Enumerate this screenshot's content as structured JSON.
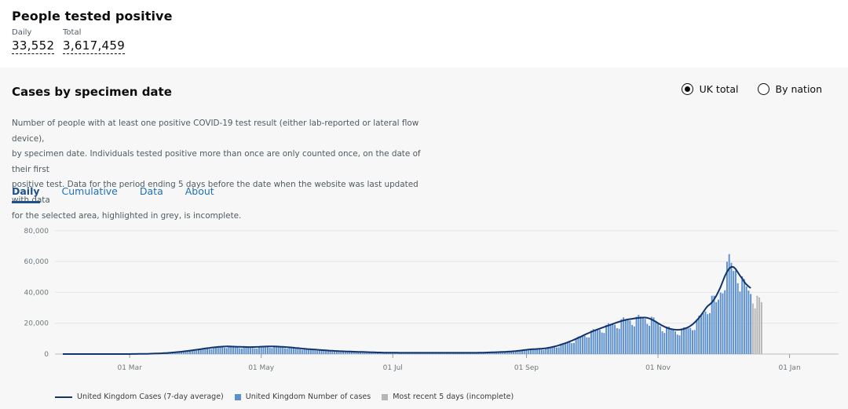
{
  "headline": {
    "title": "People tested positive",
    "daily_label": "Daily",
    "daily_value": "33,552",
    "total_label": "Total",
    "total_value": "3,617,459"
  },
  "card": {
    "title": "Cases by specimen date",
    "radio_options": [
      {
        "label": "UK total",
        "selected": true
      },
      {
        "label": "By nation",
        "selected": false
      }
    ],
    "description_lines": [
      "Number of people with at least one positive COVID-19 test result (either lab-reported or lateral flow device),",
      "by specimen date. Individuals tested positive more than once are only counted once, on the date of their first",
      "positive test. Data for the period ending 5 days before the date when the website was last updated with data",
      "for the selected area, highlighted in grey, is incomplete."
    ],
    "tabs": [
      {
        "label": "Daily",
        "active": true
      },
      {
        "label": "Cumulative",
        "active": false
      },
      {
        "label": "Data",
        "active": false
      },
      {
        "label": "About",
        "active": false
      }
    ]
  },
  "colors": {
    "bar": "#5b8fcd",
    "line": "#12336b",
    "incomplete": "#b5b5b5",
    "accent": "#1d70b8"
  },
  "chart_data": {
    "type": "bar",
    "y_ticks": [
      "80,000",
      "60,000",
      "40,000",
      "20,000",
      "0"
    ],
    "ylim": [
      0,
      85000
    ],
    "x_ticks": [
      "01 Mar",
      "01 May",
      "01 Jul",
      "01 Sep",
      "01 Nov",
      "01 Jan"
    ],
    "start_date": "2020-01-30",
    "end_date": "2021-01-23",
    "grid": true,
    "series": [
      {
        "name": "United Kingdom Cases (7-day average)",
        "kind": "line"
      },
      {
        "name": "United Kingdom Number of cases",
        "kind": "bar"
      },
      {
        "name": "Most recent 5 days (incomplete)",
        "kind": "bar"
      }
    ],
    "daily_values": [
      0,
      0,
      0,
      0,
      0,
      0,
      0,
      0,
      0,
      0,
      0,
      0,
      0,
      0,
      0,
      0,
      0,
      0,
      0,
      0,
      0,
      0,
      0,
      0,
      0,
      0,
      0,
      0,
      0,
      10,
      15,
      20,
      30,
      40,
      55,
      70,
      90,
      110,
      140,
      170,
      200,
      240,
      280,
      320,
      370,
      430,
      500,
      580,
      660,
      750,
      850,
      950,
      1100,
      1250,
      1400,
      1550,
      1700,
      1850,
      2000,
      2200,
      2400,
      2600,
      2800,
      3000,
      3200,
      3400,
      3600,
      3800,
      4000,
      4200,
      4400,
      4500,
      4700,
      4800,
      4900,
      5000,
      5000,
      4950,
      4900,
      4850,
      4800,
      4750,
      4700,
      4650,
      4600,
      4550,
      4500,
      4500,
      4500,
      4550,
      4600,
      4700,
      4800,
      4850,
      4900,
      4950,
      5000,
      5000,
      4950,
      4900,
      4850,
      4800,
      4700,
      4600,
      4500,
      4400,
      4300,
      4150,
      4000,
      3850,
      3700,
      3550,
      3400,
      3300,
      3200,
      3100,
      3000,
      2900,
      2800,
      2700,
      2600,
      2500,
      2400,
      2300,
      2200,
      2100,
      2000,
      1950,
      1900,
      1850,
      1800,
      1750,
      1700,
      1650,
      1600,
      1550,
      1500,
      1450,
      1400,
      1350,
      1300,
      1250,
      1200,
      1150,
      1100,
      1050,
      1000,
      980,
      960,
      940,
      920,
      900,
      880,
      860,
      850,
      840,
      830,
      820,
      810,
      800,
      800,
      800,
      800,
      800,
      800,
      800,
      800,
      800,
      800,
      800,
      800,
      800,
      800,
      800,
      800,
      800,
      800,
      800,
      800,
      800,
      800,
      800,
      800,
      800,
      800,
      800,
      800,
      800,
      800,
      800,
      800,
      800,
      800,
      800,
      850,
      900,
      950,
      1000,
      1050,
      1100,
      1150,
      1200,
      1250,
      1300,
      1350,
      1400,
      1500,
      1600,
      1700,
      1800,
      1900,
      2000,
      2200,
      2400,
      2600,
      2800,
      3000,
      3100,
      3200,
      3300,
      3300,
      3300,
      3400,
      3500,
      3700,
      3900,
      4200,
      4500,
      4800,
      5200,
      5600,
      6000,
      6500,
      7000,
      7500,
      8000,
      8600,
      9200,
      9800,
      10500,
      11200,
      11800,
      12500,
      13200,
      13800,
      14500,
      15000,
      15500,
      16000,
      16500,
      17000,
      17500,
      18000,
      18500,
      19000,
      19500,
      20000,
      20500,
      21000,
      21500,
      22000,
      22200,
      22500,
      22800,
      23000,
      23000,
      23000,
      23500,
      23800,
      24000,
      24000,
      23800,
      23500,
      23000,
      22000,
      21000,
      20000,
      19000,
      18000,
      17500,
      17000,
      16500,
      16000,
      15800,
      15500,
      15400,
      15500,
      15800,
      16000,
      16500,
      17000,
      17800,
      18800,
      20000,
      21500,
      23000,
      25000,
      27000,
      29000,
      31500,
      34000,
      36000,
      35000,
      33000,
      36000,
      42000,
      48000,
      53000,
      57000,
      60000,
      58000,
      55000,
      57000,
      56000,
      52000,
      48000,
      45000,
      43000,
      42000,
      41000,
      40000,
      38000,
      36000,
      34000,
      33000
    ],
    "note": ""
  }
}
